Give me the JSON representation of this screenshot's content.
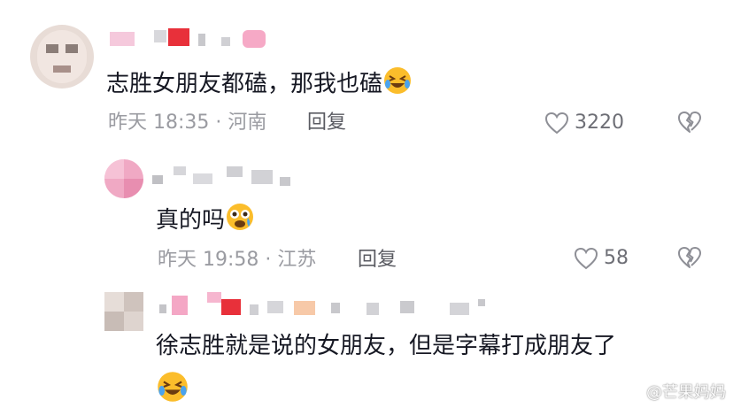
{
  "comments": [
    {
      "text": "志胜女朋友都磕，那我也磕",
      "emoji": "rolling-on-floor-laughing",
      "time": "昨天 18:35",
      "location": "河南",
      "reply_label": "回复",
      "likes": "3220"
    },
    {
      "text": "真的吗",
      "emoji": "crying-scared-face",
      "time": "昨天 19:58",
      "location": "江苏",
      "reply_label": "回复",
      "likes": "58"
    },
    {
      "text": "徐志胜就是说的女朋友，但是字幕打成朋友了",
      "emoji": "rolling-on-floor-laughing"
    }
  ],
  "watermark": "@芒果妈妈",
  "colors": {
    "meta": "#9a9ba1",
    "text": "#161823",
    "reply": "#5a5b62"
  }
}
